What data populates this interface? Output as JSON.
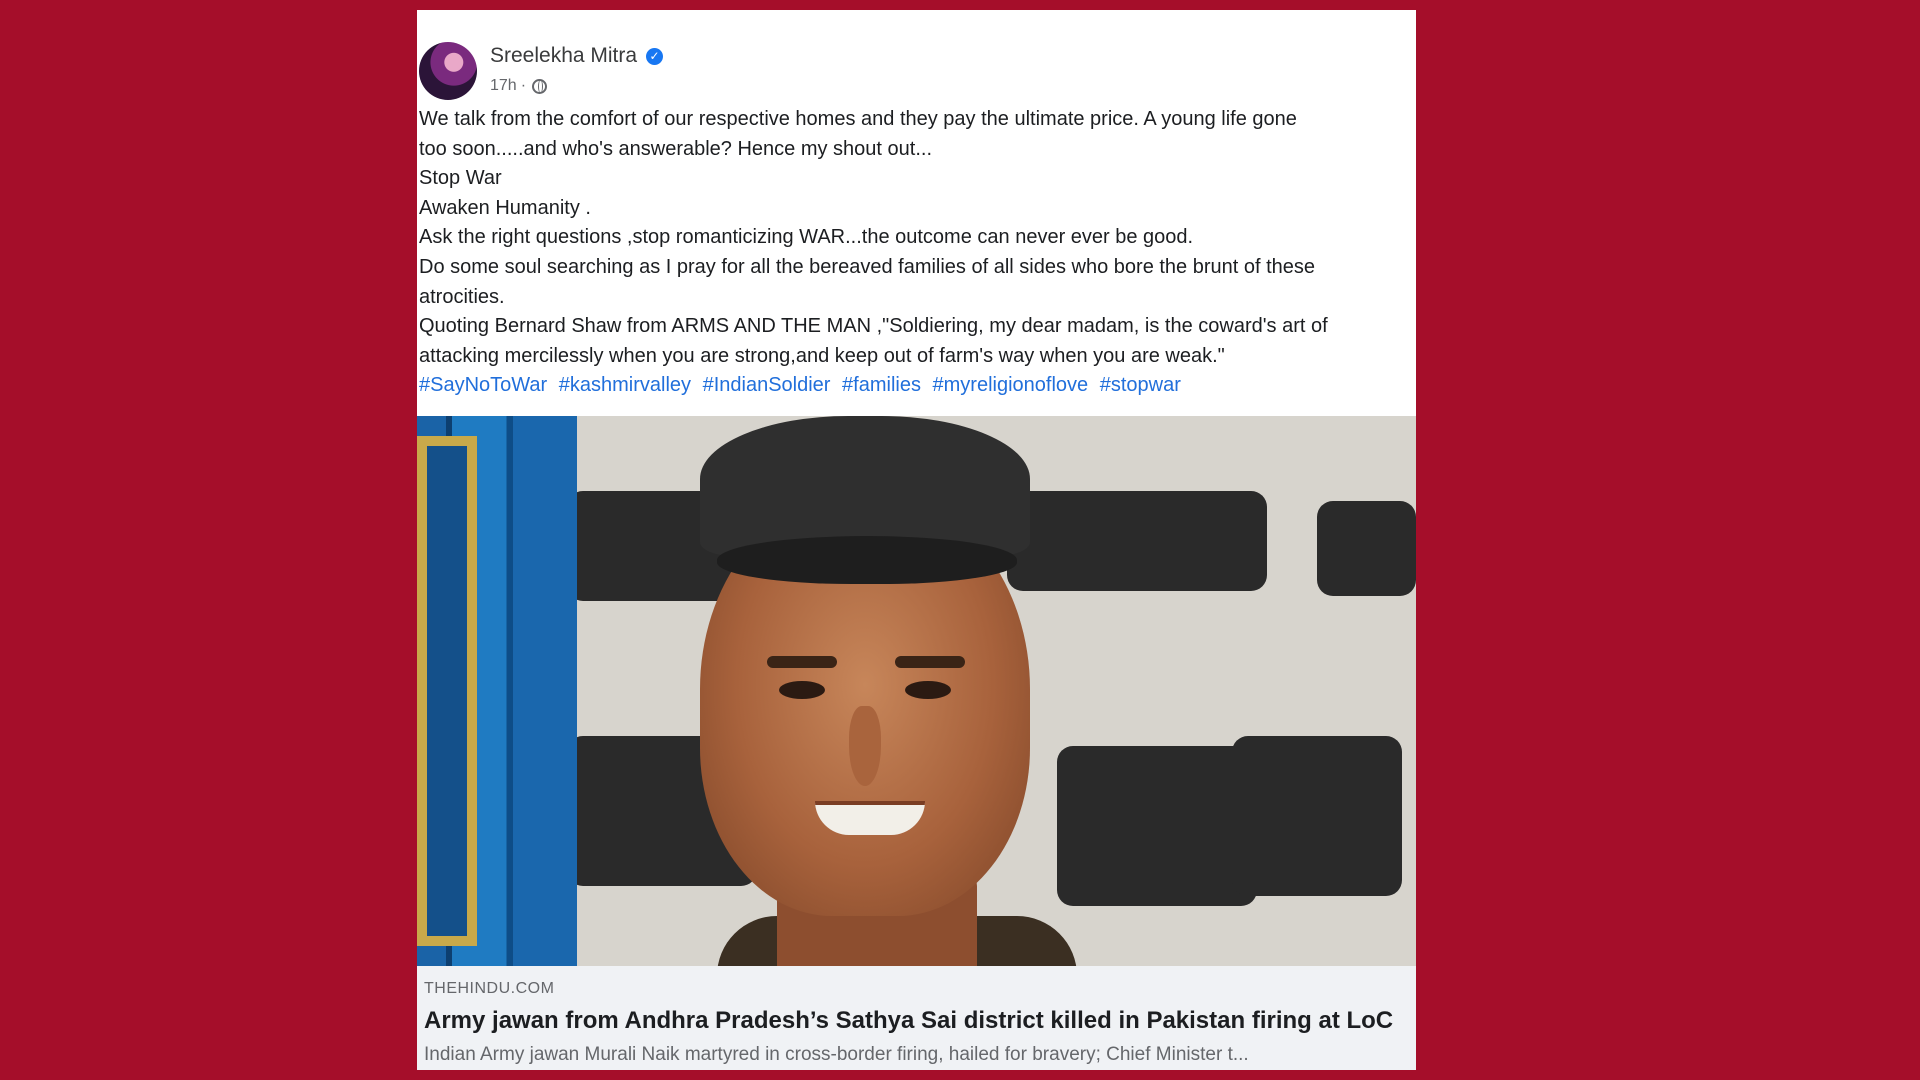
{
  "post": {
    "author": "Sreelekha Mitra",
    "verified_icon": "verified-badge-icon",
    "time": "17h",
    "separator": "·",
    "audience_icon": "globe-icon",
    "body_lines": [
      "We talk from the comfort of our respective homes and they pay the ultimate price. A young life gone",
      "too soon.....and who's answerable? Hence my shout out...",
      "Stop War",
      "Awaken Humanity .",
      "Ask the right questions ,stop romanticizing WAR...the outcome can never ever be good.",
      "Do some soul searching as I pray for all the bereaved families of all sides who bore the brunt of these",
      "atrocities.",
      "Quoting Bernard Shaw from ARMS AND THE MAN ,\"Soldiering, my dear madam, is the coward's art of",
      "attacking mercilessly when you are strong,and keep out of farm's way when you are weak.\""
    ],
    "hashtags": [
      "#SayNoToWar",
      "#kashmirvalley",
      "#IndianSoldier",
      "#families",
      "#myreligionoflove",
      "#stopwar"
    ]
  },
  "link": {
    "domain": "THEHINDU.COM",
    "title": "Army jawan from Andhra Pradesh’s Sathya Sai district killed in Pakistan firing at LoC",
    "description": "Indian Army jawan Murali Naik martyred in cross-border firing, hailed for bravery; Chief Minister t..."
  },
  "colors": {
    "background": "#a50e2a",
    "hashtag": "#216fdb",
    "verified": "#1877f2",
    "card": "#f0f2f5"
  }
}
